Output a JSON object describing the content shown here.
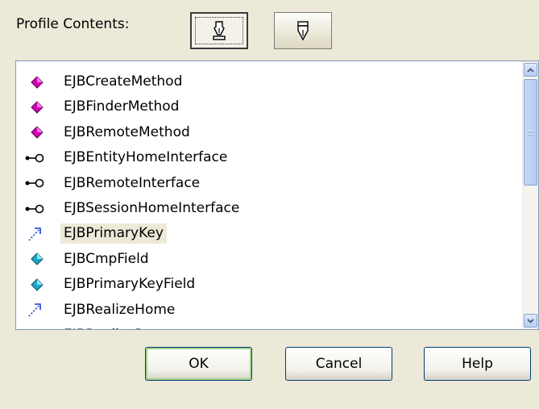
{
  "header": {
    "profile_label": "Profile Contents:",
    "tools": [
      {
        "icon": "pen-nib-icon",
        "active": true
      },
      {
        "icon": "pen-tip-icon",
        "active": false
      }
    ]
  },
  "list": {
    "items": [
      {
        "label": "EJBCreateMethod",
        "icon": "magenta-diamond-icon"
      },
      {
        "label": "EJBFinderMethod",
        "icon": "magenta-diamond-icon"
      },
      {
        "label": "EJBRemoteMethod",
        "icon": "magenta-diamond-icon"
      },
      {
        "label": "EJBEntityHomeInterface",
        "icon": "interface-lollipop-icon"
      },
      {
        "label": "EJBRemoteInterface",
        "icon": "interface-lollipop-icon"
      },
      {
        "label": "EJBSessionHomeInterface",
        "icon": "interface-lollipop-icon"
      },
      {
        "label": "EJBPrimaryKey",
        "icon": "dependency-arrow-icon",
        "selected": true
      },
      {
        "label": "EJBCmpField",
        "icon": "cyan-diamond-icon"
      },
      {
        "label": "EJBPrimaryKeyField",
        "icon": "cyan-diamond-icon"
      },
      {
        "label": "EJBRealizeHome",
        "icon": "dependency-arrow-icon"
      },
      {
        "label": "EJBRealizeRemote",
        "icon": "dependency-arrow-icon"
      }
    ]
  },
  "buttons": {
    "ok": "OK",
    "cancel": "Cancel",
    "help": "Help"
  },
  "colors": {
    "dialog_bg": "#ECE9D8",
    "method_icon": "#D400B4",
    "field_icon": "#1CA8C8",
    "dependency_icon": "#1A3FD8",
    "selection_bg": "#ECE9D8"
  }
}
